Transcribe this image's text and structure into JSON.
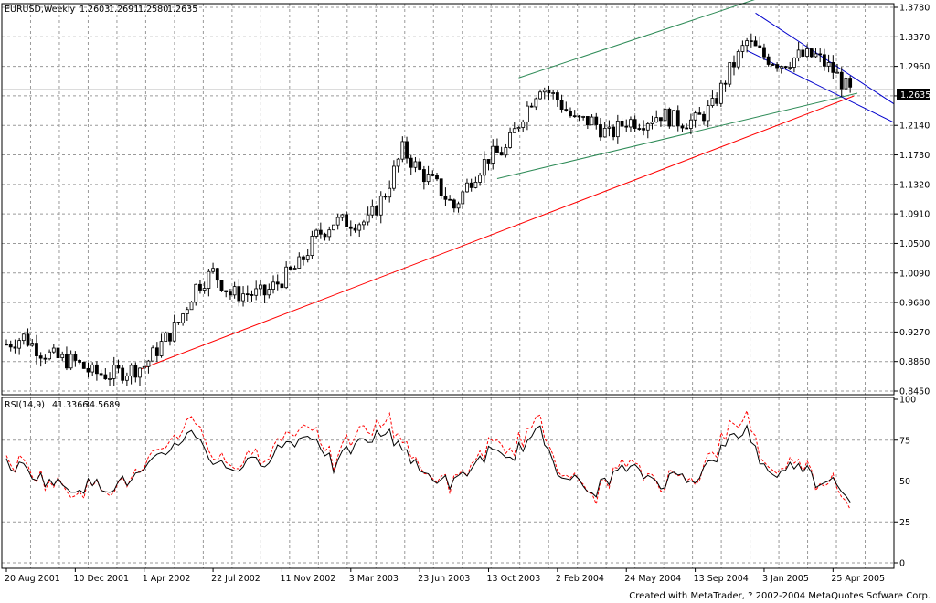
{
  "chart_data": {
    "type": "candlestick",
    "main_panel": {
      "header": {
        "symbol": "EURUSD,Weekly",
        "open": "1.2603",
        "high": "1.2691",
        "low": "1.2580",
        "close": "1.2635"
      },
      "y_ticks": [
        "1.3780",
        "1.3370",
        "1.2960",
        "1.2550",
        "1.2140",
        "1.1730",
        "1.1320",
        "1.0910",
        "1.0500",
        "1.0090",
        "0.9680",
        "0.9270",
        "0.8860",
        "0.8450"
      ],
      "ylim": [
        0.845,
        1.378
      ],
      "current_price": "1.2635",
      "colors": {
        "candles": "#000000",
        "support_line": "#ff0000",
        "up_channel": "#2e8b57",
        "down_channel": "#0000cc",
        "grid": "#9a9a9a"
      },
      "anchor_closes": [
        [
          "2001-08-20",
          0.91
        ],
        [
          "2001-09-17",
          0.92
        ],
        [
          "2001-10-15",
          0.9
        ],
        [
          "2001-11-12",
          0.89
        ],
        [
          "2001-12-10",
          0.885
        ],
        [
          "2002-01-07",
          0.87
        ],
        [
          "2002-02-04",
          0.868
        ],
        [
          "2002-03-04",
          0.873
        ],
        [
          "2002-04-01",
          0.88
        ],
        [
          "2002-04-29",
          0.91
        ],
        [
          "2002-05-27",
          0.94
        ],
        [
          "2002-06-24",
          0.99
        ],
        [
          "2002-07-22",
          1.01
        ],
        [
          "2002-08-19",
          0.98
        ],
        [
          "2002-09-16",
          0.98
        ],
        [
          "2002-10-14",
          0.98
        ],
        [
          "2002-11-11",
          1.0
        ],
        [
          "2002-12-09",
          1.02
        ],
        [
          "2003-01-06",
          1.06
        ],
        [
          "2003-02-03",
          1.08
        ],
        [
          "2003-03-03",
          1.08
        ],
        [
          "2003-03-31",
          1.08
        ],
        [
          "2003-04-28",
          1.12
        ],
        [
          "2003-05-26",
          1.18
        ],
        [
          "2003-06-23",
          1.15
        ],
        [
          "2003-07-21",
          1.13
        ],
        [
          "2003-08-18",
          1.1
        ],
        [
          "2003-09-15",
          1.14
        ],
        [
          "2003-10-13",
          1.17
        ],
        [
          "2003-11-10",
          1.18
        ],
        [
          "2003-12-08",
          1.23
        ],
        [
          "2004-01-05",
          1.27
        ],
        [
          "2004-02-02",
          1.25
        ],
        [
          "2004-03-01",
          1.22
        ],
        [
          "2004-03-29",
          1.22
        ],
        [
          "2004-04-26",
          1.2
        ],
        [
          "2004-05-24",
          1.22
        ],
        [
          "2004-06-21",
          1.22
        ],
        [
          "2004-07-19",
          1.23
        ],
        [
          "2004-08-16",
          1.22
        ],
        [
          "2004-09-13",
          1.22
        ],
        [
          "2004-10-11",
          1.24
        ],
        [
          "2004-11-08",
          1.29
        ],
        [
          "2004-12-06",
          1.33
        ],
        [
          "2005-01-03",
          1.31
        ],
        [
          "2005-01-31",
          1.3
        ],
        [
          "2005-02-28",
          1.31
        ],
        [
          "2005-03-28",
          1.31
        ],
        [
          "2005-04-25",
          1.29
        ],
        [
          "2005-05-23",
          1.26
        ]
      ],
      "trendlines": {
        "support": [
          [
            "2002-03-25",
            0.875
          ],
          [
            "2005-06-20",
            1.262
          ]
        ],
        "up_channel_upper": [
          [
            "2003-12-01",
            1.28
          ],
          [
            "2005-02-14",
            1.405
          ]
        ],
        "up_channel_lower": [
          [
            "2003-10-27",
            1.14
          ],
          [
            "2005-06-20",
            1.262
          ]
        ],
        "down_channel_upper": [
          [
            "2004-12-20",
            1.37
          ],
          [
            "2005-06-20",
            1.268
          ]
        ],
        "down_channel_lower": [
          [
            "2004-12-06",
            1.318
          ],
          [
            "2005-06-20",
            1.236
          ]
        ]
      }
    },
    "rsi_panel": {
      "label": "RSI(14,9)",
      "value1": "41.3366",
      "value2": "34.5689",
      "y_ticks": [
        "100",
        "75",
        "50",
        "25",
        "0"
      ],
      "ylim": [
        0,
        100
      ],
      "colors": {
        "rsi": "#000000",
        "signal": "#ff0000"
      },
      "anchor_values": [
        [
          "2001-08-20",
          60
        ],
        [
          "2001-09-17",
          58
        ],
        [
          "2001-10-15",
          52
        ],
        [
          "2001-11-12",
          48
        ],
        [
          "2001-12-10",
          46
        ],
        [
          "2002-01-07",
          48
        ],
        [
          "2002-02-04",
          47
        ],
        [
          "2002-03-04",
          50
        ],
        [
          "2002-04-01",
          55
        ],
        [
          "2002-04-29",
          65
        ],
        [
          "2002-05-27",
          75
        ],
        [
          "2002-06-24",
          80
        ],
        [
          "2002-07-22",
          62
        ],
        [
          "2002-08-19",
          58
        ],
        [
          "2002-09-16",
          60
        ],
        [
          "2002-10-14",
          63
        ],
        [
          "2002-11-11",
          72
        ],
        [
          "2002-12-09",
          76
        ],
        [
          "2003-01-06",
          78
        ],
        [
          "2003-02-03",
          58
        ],
        [
          "2003-03-03",
          70
        ],
        [
          "2003-03-31",
          75
        ],
        [
          "2003-04-28",
          80
        ],
        [
          "2003-05-26",
          72
        ],
        [
          "2003-06-23",
          55
        ],
        [
          "2003-07-21",
          52
        ],
        [
          "2003-08-18",
          48
        ],
        [
          "2003-09-15",
          58
        ],
        [
          "2003-10-13",
          68
        ],
        [
          "2003-11-10",
          62
        ],
        [
          "2003-12-08",
          72
        ],
        [
          "2004-01-05",
          80
        ],
        [
          "2004-02-02",
          58
        ],
        [
          "2004-03-01",
          50
        ],
        [
          "2004-03-29",
          42
        ],
        [
          "2004-04-26",
          52
        ],
        [
          "2004-05-24",
          58
        ],
        [
          "2004-06-21",
          54
        ],
        [
          "2004-07-19",
          49
        ],
        [
          "2004-08-16",
          54
        ],
        [
          "2004-09-13",
          52
        ],
        [
          "2004-10-11",
          62
        ],
        [
          "2004-11-08",
          75
        ],
        [
          "2004-12-06",
          82
        ],
        [
          "2005-01-03",
          58
        ],
        [
          "2005-01-31",
          54
        ],
        [
          "2005-02-28",
          63
        ],
        [
          "2005-03-28",
          50
        ],
        [
          "2005-04-25",
          52
        ],
        [
          "2005-05-23",
          41
        ]
      ]
    },
    "x_axis": {
      "start_date": "2001-08-20",
      "end_date": "2005-06-20",
      "labels": [
        [
          "2001-08-20",
          "20 Aug 2001"
        ],
        [
          "2001-12-10",
          "10 Dec 2001"
        ],
        [
          "2002-04-01",
          "1 Apr 2002"
        ],
        [
          "2002-07-22",
          "22 Jul 2002"
        ],
        [
          "2002-11-11",
          "11 Nov 2002"
        ],
        [
          "2003-03-03",
          "3 Mar 2003"
        ],
        [
          "2003-06-23",
          "23 Jun 2003"
        ],
        [
          "2003-10-13",
          "13 Oct 2003"
        ],
        [
          "2004-02-02",
          "2 Feb 2004"
        ],
        [
          "2004-05-24",
          "24 May 2004"
        ],
        [
          "2004-09-13",
          "13 Sep 2004"
        ],
        [
          "2005-01-03",
          "3 Jan 2005"
        ],
        [
          "2005-04-25",
          "25 Apr 2005"
        ]
      ]
    }
  },
  "footer": {
    "credit": "Created with MetaTrader, ? 2002-2004 MetaQuotes Sofware Corp."
  }
}
